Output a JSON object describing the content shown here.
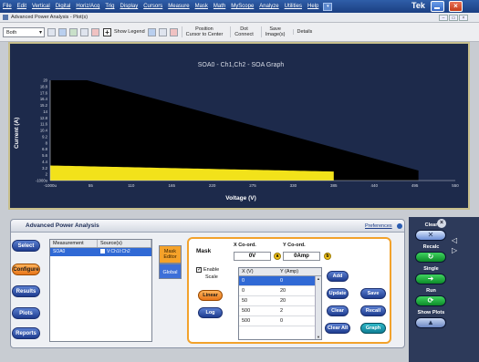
{
  "menu": {
    "items": [
      "File",
      "Edit",
      "Vertical",
      "Digital",
      "Horiz/Acq",
      "Trig",
      "Display",
      "Cursors",
      "Measure",
      "Mask",
      "Math",
      "MyScope",
      "Analyze",
      "Utilities",
      "Help"
    ],
    "brand": "Tek"
  },
  "plot_window": {
    "title": "Advanced Power Analysis - Plot(s)"
  },
  "toolbar": {
    "view_select": "Both",
    "show_legend": "Show Legend",
    "position_label": "Position\nCursor to Center",
    "dot_connect": "Dot\nConnect",
    "save_images": "Save\nImage(s)",
    "details": "Details"
  },
  "chart_data": {
    "type": "scatter",
    "title": "SOA0 - Ch1,Ch2 - SOA Graph",
    "xlabel": "Voltage (V)",
    "ylabel": "Current (A)",
    "x_ticks": [
      "-1000u",
      "55",
      "110",
      "165",
      "220",
      "275",
      "330",
      "385",
      "440",
      "495",
      "550"
    ],
    "y_ticks": [
      "20",
      "18.8",
      "17.6",
      "16.4",
      "15.2",
      "14",
      "12.8",
      "11.6",
      "10.4",
      "9.2",
      "8",
      "6.8",
      "5.6",
      "4.4",
      "3.2",
      "2",
      "-1000u"
    ],
    "xlim": [
      -0.001,
      550
    ],
    "ylim": [
      -0.001,
      20
    ],
    "mask": {
      "x": [
        0,
        0,
        50,
        500,
        500
      ],
      "y": [
        0,
        20,
        20,
        2,
        0
      ]
    },
    "colors": {
      "mask_fill": "#000000",
      "data": "#f2e21a",
      "background": "#1d2a4b"
    }
  },
  "panel": {
    "title": "Advanced Power Analysis",
    "preferences": "Preferences",
    "nav": [
      "Select",
      "Configure",
      "Results",
      "Plots",
      "Reports"
    ],
    "active_nav": "Configure",
    "meas_table": {
      "headers": [
        "Measurement",
        "Source(s)"
      ],
      "rows": [
        {
          "measurement": "SOA0",
          "source": "V:Ch1I:Ch2"
        }
      ]
    },
    "tabs": [
      "Mask\nEditor",
      "Global"
    ],
    "mask": {
      "title": "Mask",
      "enable": "Enable",
      "scale": "Scale",
      "x_coord_label": "X Co-ord.",
      "y_coord_label": "Y Co-ord.",
      "x_coord_value": "0V",
      "y_coord_value": "0Amp",
      "knob_a": "a",
      "knob_b": "b",
      "linear": "Linear",
      "log": "Log",
      "table_headers": [
        "X (V)",
        "Y (Amp)"
      ],
      "points": [
        [
          "0",
          "0"
        ],
        [
          "0",
          "20"
        ],
        [
          "50",
          "20"
        ],
        [
          "500",
          "2"
        ],
        [
          "500",
          "0"
        ]
      ],
      "buttons": {
        "add": "Add",
        "update": "Update",
        "clear": "Clear",
        "clear_all": "Clear All",
        "save": "Save",
        "recall": "Recall",
        "graph": "Graph"
      }
    }
  },
  "side_panel": {
    "clear": "Clear",
    "recalc": "Recalc",
    "single": "Single",
    "run": "Run",
    "show_plots": "Show Plots"
  }
}
